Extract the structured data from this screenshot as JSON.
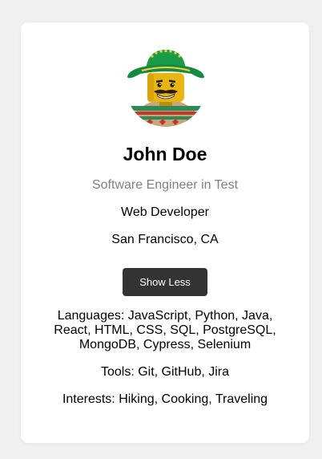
{
  "profile": {
    "avatar_icon": "lego-minifigure-sombrero-avatar",
    "name": "John Doe",
    "subtitle": "Software Engineer in Test",
    "role": "Web Developer",
    "location": "San Francisco, CA",
    "toggle_label": "Show Less",
    "languages": "Languages: JavaScript, Python, Java, React, HTML, CSS, SQL, PostgreSQL, MongoDB, Cypress, Selenium",
    "tools": "Tools: Git, GitHub, Jira",
    "interests": "Interests: Hiking, Cooking, Traveling"
  },
  "colors": {
    "page_background": "#f0f0f0",
    "card_background": "#ffffff",
    "button_background": "#333333",
    "button_text": "#ffffff",
    "subtitle_text": "#808080",
    "sombrero_green": "#1a9b4a",
    "lego_yellow": "#e8b511"
  }
}
